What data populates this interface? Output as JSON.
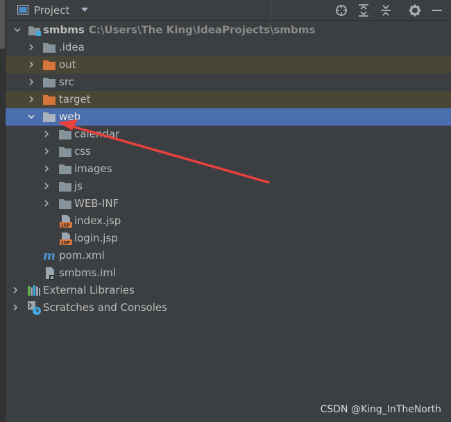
{
  "header": {
    "title": "Project",
    "tools": [
      "locate-icon",
      "expand-all-icon",
      "collapse-all-icon",
      "gear-icon",
      "minimize-icon"
    ]
  },
  "tree": {
    "root": {
      "label": "smbms",
      "path": "C:\\Users\\The King\\IdeaProjects\\smbms"
    },
    "items": [
      {
        "label": ".idea",
        "icon": "folder-icon"
      },
      {
        "label": "out",
        "icon": "excluded-folder-icon"
      },
      {
        "label": "src",
        "icon": "folder-icon"
      },
      {
        "label": "target",
        "icon": "excluded-folder-icon"
      },
      {
        "label": "web",
        "icon": "folder-icon"
      },
      {
        "label": "calendar",
        "icon": "folder-icon"
      },
      {
        "label": "css",
        "icon": "folder-icon"
      },
      {
        "label": "images",
        "icon": "folder-icon"
      },
      {
        "label": "js",
        "icon": "folder-icon"
      },
      {
        "label": "WEB-INF",
        "icon": "folder-icon"
      },
      {
        "label": "index.jsp",
        "icon": "jsp-file-icon"
      },
      {
        "label": "login.jsp",
        "icon": "jsp-file-icon"
      },
      {
        "label": "pom.xml",
        "icon": "maven-icon"
      },
      {
        "label": "smbms.iml",
        "icon": "iml-file-icon"
      },
      {
        "label": "External Libraries",
        "icon": "libraries-icon"
      },
      {
        "label": "Scratches and Consoles",
        "icon": "scratches-icon"
      }
    ],
    "jsp_badge": "JSP"
  },
  "colors": {
    "background": "#3c3f41",
    "selection": "#4b6eaf",
    "excluded_row": "#494636",
    "folder": "#87939a",
    "excluded_folder": "#d5753b",
    "annotation_arrow": "#e8413c"
  },
  "watermark": "CSDN @King_InTheNorth"
}
